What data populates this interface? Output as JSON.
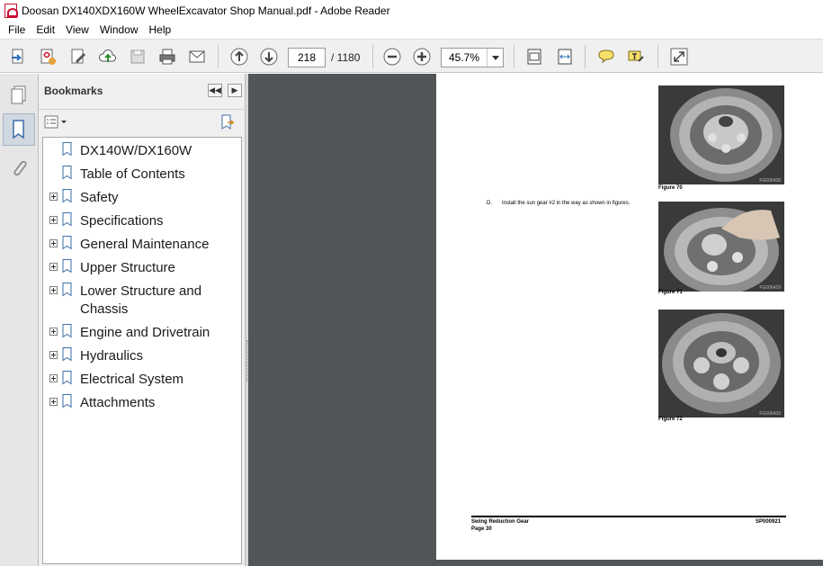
{
  "window": {
    "title": "Doosan DX140XDX160W WheelExcavator Shop Manual.pdf - Adobe Reader"
  },
  "menu": [
    "File",
    "Edit",
    "View",
    "Window",
    "Help"
  ],
  "toolbar": {
    "current_page": "218",
    "total_pages": "/  1180",
    "zoom": "45.7%"
  },
  "bookmarks": {
    "title": "Bookmarks",
    "items": [
      {
        "label": "DX140W/DX160W",
        "expandable": false
      },
      {
        "label": "Table of Contents",
        "expandable": false
      },
      {
        "label": "Safety",
        "expandable": true
      },
      {
        "label": "Specifications",
        "expandable": true
      },
      {
        "label": "General Maintenance",
        "expandable": true
      },
      {
        "label": "Upper Structure",
        "expandable": true
      },
      {
        "label": "Lower Structure and Chassis",
        "expandable": true
      },
      {
        "label": "Engine and Drivetrain",
        "expandable": true
      },
      {
        "label": "Hydraulics",
        "expandable": true
      },
      {
        "label": "Electrical System",
        "expandable": true
      },
      {
        "label": "Attachments",
        "expandable": true
      }
    ]
  },
  "document": {
    "figures": [
      {
        "caption": "Figure 70",
        "code": "FG006428"
      },
      {
        "caption": "Figure 71",
        "code": "FG006429"
      },
      {
        "caption": "Figure 72",
        "code": "FG006430"
      }
    ],
    "step": {
      "letter": "D.",
      "text": "Install the sun gear #2 in the way as shown in figures."
    },
    "footer": {
      "section": "Swing Reduction Gear",
      "page": "Page 30",
      "code": "SP000921"
    }
  },
  "colors": {
    "doc_background": "#525659",
    "toolbar_background": "#f0f0f0",
    "panel_background": "#f0f0f0"
  }
}
